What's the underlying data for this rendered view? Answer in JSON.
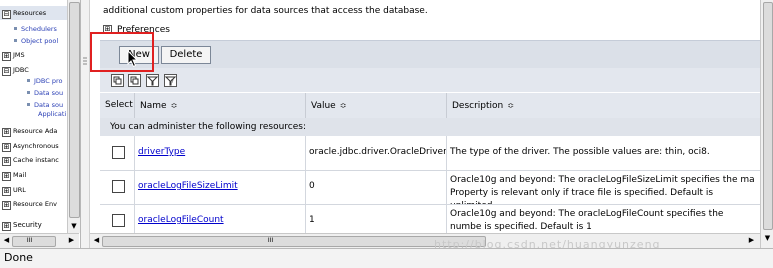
{
  "nav": {
    "items": [
      {
        "label": "Resources",
        "toggle": "⊟"
      },
      {
        "label": "Schedulers",
        "toggle": ""
      },
      {
        "label": "Object pool",
        "toggle": ""
      },
      {
        "label": "JMS",
        "toggle": "⊞"
      },
      {
        "label": "JDBC",
        "toggle": "⊟"
      },
      {
        "label": "JDBC pro",
        "toggle": ""
      },
      {
        "label": "Data sou",
        "toggle": ""
      },
      {
        "label": "Data sou",
        "toggle": ""
      },
      {
        "label": "Applicati",
        "toggle": ""
      },
      {
        "label": "Resource Ada",
        "toggle": "⊞"
      },
      {
        "label": "Asynchronous",
        "toggle": "⊞"
      },
      {
        "label": "Cache instanc",
        "toggle": "⊞"
      },
      {
        "label": "Mail",
        "toggle": "⊞"
      },
      {
        "label": "URL",
        "toggle": "⊞"
      },
      {
        "label": "Resource Env",
        "toggle": "⊞"
      }
    ],
    "bottom_item": {
      "label": "Security",
      "toggle": "⊞"
    }
  },
  "main": {
    "intro_text": "additional custom properties for data sources that access the database.",
    "preferences_label": "Preferences",
    "preferences_toggle": "⊞",
    "buttons": {
      "new": "New",
      "delete": "Delete"
    },
    "icons": [
      "select-all-icon",
      "deselect-all-icon",
      "show-filter-icon",
      "clear-filter-icon"
    ],
    "table": {
      "columns": [
        "Select",
        "Name",
        "Value",
        "Description"
      ],
      "sort_glyph": "≎",
      "admin_text": "You can administer the following resources:",
      "rows": [
        {
          "name": "driverType",
          "value": "oracle.jdbc.driver.OracleDriver",
          "description": "The type of the driver. The possible values are: thin, oci8."
        },
        {
          "name": "oracleLogFileSizeLimit",
          "value": "0",
          "description": "Oracle10g and beyond: The oracleLogFileSizeLimit specifies the ma Property is relevant only if trace file is specified. Default is unlimited"
        },
        {
          "name": "oracleLogFileCount",
          "value": "1",
          "description": "Oracle10g and beyond: The oracleLogFileCount specifies the numbe is specified. Default is 1"
        }
      ]
    }
  },
  "scroll": {
    "left_arrow": "◀",
    "right_arrow": "▶",
    "down_arrow": "▼",
    "grip": "III"
  },
  "status": {
    "text": "Done"
  },
  "watermark": "http://blog.csdn.net/huangyunzeng"
}
